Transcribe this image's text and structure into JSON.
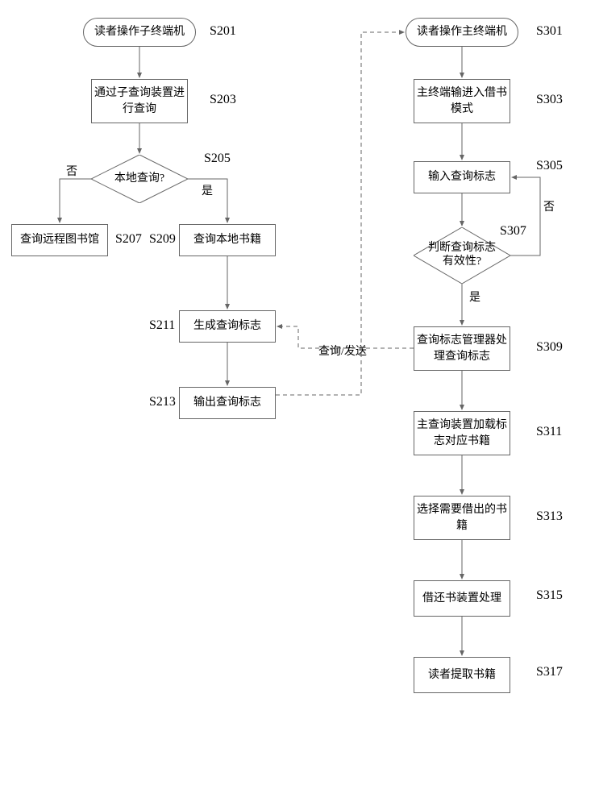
{
  "left": {
    "s201": {
      "text": "读者操作子终端机",
      "label": "S201"
    },
    "s203": {
      "text": "通过子查询装置进行查询",
      "label": "S203"
    },
    "s205": {
      "text": "本地查询?",
      "label": "S205",
      "no": "否",
      "yes": "是"
    },
    "s207": {
      "text": "查询远程图书馆",
      "label": "S207"
    },
    "s209": {
      "text": "查询本地书籍",
      "label": "S209"
    },
    "s211": {
      "text": "生成查询标志",
      "label": "S211"
    },
    "s213": {
      "text": "输出查询标志",
      "label": "S213"
    }
  },
  "right": {
    "s301": {
      "text": "读者操作主终端机",
      "label": "S301"
    },
    "s303": {
      "text": "主终端输进入借书模式",
      "label": "S303"
    },
    "s305": {
      "text": "输入查询标志",
      "label": "S305"
    },
    "s307": {
      "text": "判断查询标志有效性?",
      "label": "S307",
      "no": "否",
      "yes": "是"
    },
    "s309": {
      "text": "查询标志管理器处理查询标志",
      "label": "S309"
    },
    "s311": {
      "text": "主查询装置加载标志对应书籍",
      "label": "S311"
    },
    "s313": {
      "text": "选择需要借出的书籍",
      "label": "S313"
    },
    "s315": {
      "text": "借还书装置处理",
      "label": "S315"
    },
    "s317": {
      "text": "读者提取书籍",
      "label": "S317"
    }
  },
  "dashed_label": "查询/发送"
}
